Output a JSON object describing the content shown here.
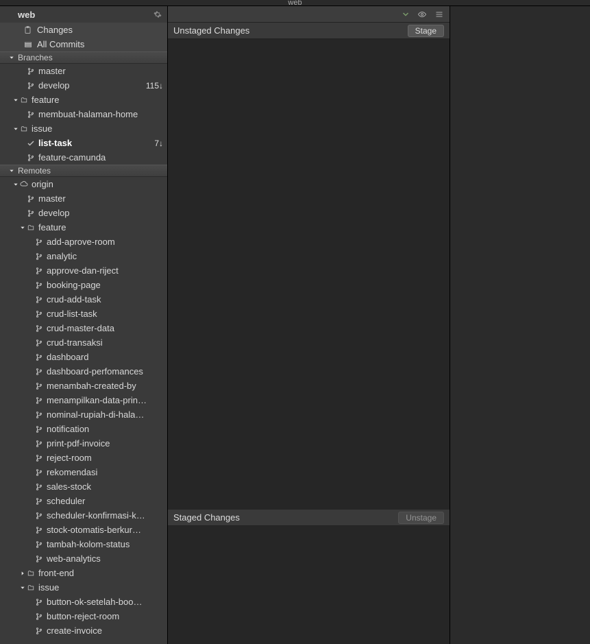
{
  "top_tab": "web",
  "sidebar": {
    "title": "web",
    "topitems": [
      {
        "icon": "changes",
        "label": "Changes"
      },
      {
        "icon": "commits",
        "label": "All Commits"
      }
    ],
    "sections": [
      {
        "name": "Branches",
        "rows": [
          {
            "type": "branch",
            "depth": 2,
            "label": "master"
          },
          {
            "type": "branch",
            "depth": 2,
            "label": "develop",
            "meta": "115↓"
          },
          {
            "type": "folder",
            "depth": 1,
            "label": "feature",
            "expanded": true
          },
          {
            "type": "branch",
            "depth": 2,
            "label": "membuat-halaman-home"
          },
          {
            "type": "folder",
            "depth": 1,
            "label": "issue",
            "expanded": true
          },
          {
            "type": "current",
            "depth": 2,
            "label": "list-task",
            "meta": "7↓",
            "active": true
          },
          {
            "type": "branch",
            "depth": 2,
            "label": "feature-camunda"
          }
        ]
      },
      {
        "name": "Remotes",
        "rows": [
          {
            "type": "remote",
            "depth": 1,
            "label": "origin",
            "expanded": true
          },
          {
            "type": "branch",
            "depth": 2,
            "label": "master"
          },
          {
            "type": "branch",
            "depth": 2,
            "label": "develop"
          },
          {
            "type": "folder",
            "depth": 2,
            "label": "feature",
            "expanded": true
          },
          {
            "type": "branch",
            "depth": 3,
            "label": "add-aprove-room"
          },
          {
            "type": "branch",
            "depth": 3,
            "label": "analytic"
          },
          {
            "type": "branch",
            "depth": 3,
            "label": "approve-dan-riject"
          },
          {
            "type": "branch",
            "depth": 3,
            "label": "booking-page"
          },
          {
            "type": "branch",
            "depth": 3,
            "label": "crud-add-task"
          },
          {
            "type": "branch",
            "depth": 3,
            "label": "crud-list-task"
          },
          {
            "type": "branch",
            "depth": 3,
            "label": "crud-master-data"
          },
          {
            "type": "branch",
            "depth": 3,
            "label": "crud-transaksi"
          },
          {
            "type": "branch",
            "depth": 3,
            "label": "dashboard"
          },
          {
            "type": "branch",
            "depth": 3,
            "label": "dashboard-perfomances"
          },
          {
            "type": "branch",
            "depth": 3,
            "label": "menambah-created-by"
          },
          {
            "type": "branch",
            "depth": 3,
            "label": "menampilkan-data-prin…"
          },
          {
            "type": "branch",
            "depth": 3,
            "label": "nominal-rupiah-di-hala…"
          },
          {
            "type": "branch",
            "depth": 3,
            "label": "notification"
          },
          {
            "type": "branch",
            "depth": 3,
            "label": "print-pdf-invoice"
          },
          {
            "type": "branch",
            "depth": 3,
            "label": "reject-room"
          },
          {
            "type": "branch",
            "depth": 3,
            "label": "rekomendasi"
          },
          {
            "type": "branch",
            "depth": 3,
            "label": "sales-stock"
          },
          {
            "type": "branch",
            "depth": 3,
            "label": "scheduler"
          },
          {
            "type": "branch",
            "depth": 3,
            "label": "scheduler-konfirmasi-k…"
          },
          {
            "type": "branch",
            "depth": 3,
            "label": "stock-otomatis-berkur…"
          },
          {
            "type": "branch",
            "depth": 3,
            "label": "tambah-kolom-status"
          },
          {
            "type": "branch",
            "depth": 3,
            "label": "web-analytics"
          },
          {
            "type": "folder",
            "depth": 2,
            "label": "front-end",
            "expanded": false
          },
          {
            "type": "folder",
            "depth": 2,
            "label": "issue",
            "expanded": true
          },
          {
            "type": "branch",
            "depth": 3,
            "label": "button-ok-setelah-boo…"
          },
          {
            "type": "branch",
            "depth": 3,
            "label": "button-reject-room"
          },
          {
            "type": "branch",
            "depth": 3,
            "label": "create-invoice"
          }
        ]
      }
    ]
  },
  "center": {
    "unstaged_title": "Unstaged Changes",
    "stage_btn": "Stage",
    "staged_title": "Staged Changes",
    "unstage_btn": "Unstage"
  }
}
